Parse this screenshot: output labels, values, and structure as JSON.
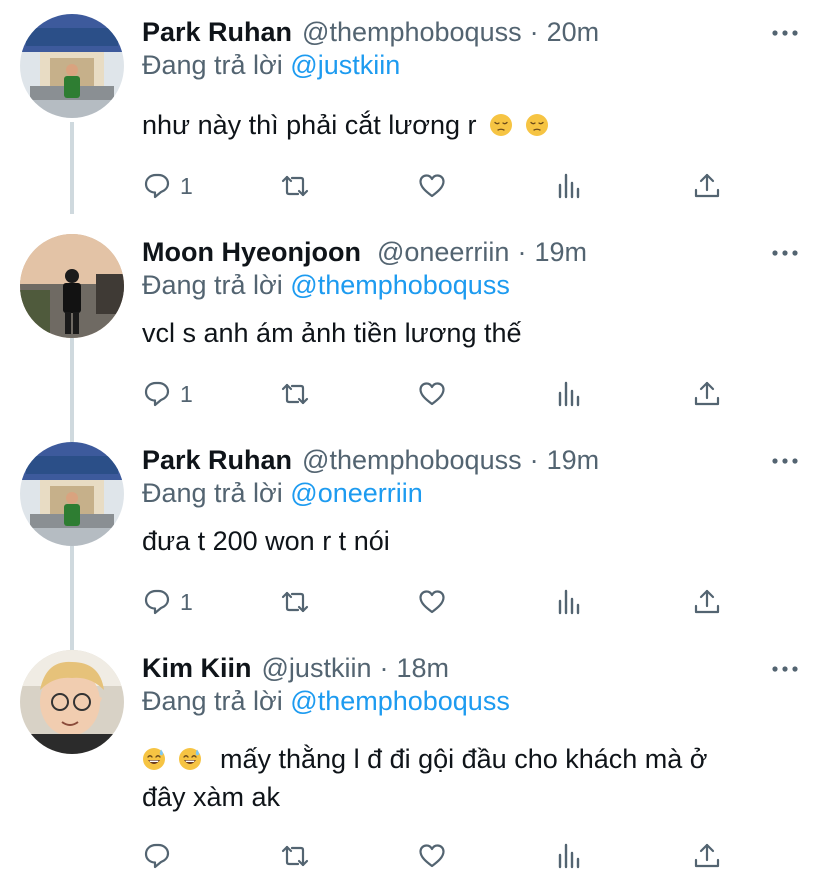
{
  "colors": {
    "text": "#0f1419",
    "secondary": "#536471",
    "accent": "#1d9bf0",
    "thread_line": "#cfd9de"
  },
  "icons": {
    "reply": "reply-icon",
    "retweet": "retweet-icon",
    "like": "heart-icon",
    "analytics": "analytics-icon",
    "share": "share-icon",
    "more": "more-icon"
  },
  "tweets": [
    {
      "name": "Park Ruhan",
      "handle": "@themphoboquss",
      "sep": "·",
      "time": "20m",
      "replying_prefix": "Đang trả lời",
      "replying_to": "@justkiin",
      "text": "như này thì phải cắt lương r",
      "emoji": [
        "pensive-face",
        "pensive-face"
      ],
      "reply_count": "1"
    },
    {
      "name": "Moon Hyeonjoon",
      "handle": "@oneerriin",
      "sep": "·",
      "time": "19m",
      "replying_prefix": "Đang trả lời",
      "replying_to": "@themphoboquss",
      "text": "vcl s anh ám ảnh tiền lương thế",
      "reply_count": "1"
    },
    {
      "name": "Park Ruhan",
      "handle": "@themphoboquss",
      "sep": "·",
      "time": "19m",
      "replying_prefix": "Đang trả lời",
      "replying_to": "@oneerriin",
      "text": "đưa t 200 won r t nói",
      "reply_count": "1"
    },
    {
      "name": "Kim Kiin",
      "handle": "@justkiin",
      "sep": "·",
      "time": "18m",
      "replying_prefix": "Đang trả lời",
      "replying_to": "@themphoboquss",
      "emoji": [
        "grinning-sweat-face",
        "grinning-sweat-face"
      ],
      "text_line1": "mấy thằng l đ đi gội đầu cho khách mà ở",
      "text_line2": "đây xàm ak",
      "reply_count": ""
    }
  ]
}
